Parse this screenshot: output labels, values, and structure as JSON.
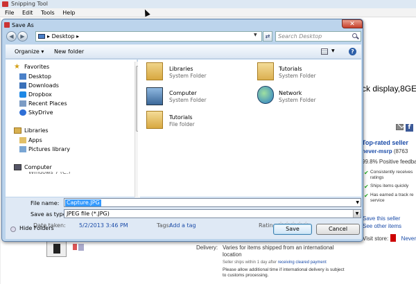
{
  "snipping_tool": {
    "title": "Snipping Tool",
    "menu": [
      "File",
      "Edit",
      "Tools",
      "Help"
    ]
  },
  "background_page": {
    "product_title_fragment": "ck display,8GE",
    "top_rated": "Top-rated seller",
    "seller_name": "never-msrp",
    "seller_count": "(8763",
    "feedback": "99.8% Positive feedba",
    "bullets": [
      "Consistently receives ratings",
      "Ships items quickly",
      "Has earned a track re service"
    ],
    "save_seller": "Save this seller",
    "see_other": "See other items",
    "visit_store": "Visit store:",
    "store_name": "Never",
    "delivery_label": "Delivery:",
    "delivery_value": "Varies for items shipped from an international location",
    "seller_ships_prefix": "Seller ships within 1 day after",
    "seller_ships_link": "receiving cleared payment",
    "allow_time": "Please allow additional time if international delivery is subject to customs processing."
  },
  "dialog": {
    "title": "Save As",
    "address_location": "Desktop",
    "search_placeholder": "Search Desktop",
    "toolbar": {
      "organize": "Organize",
      "new_folder": "New folder"
    },
    "nav": {
      "favorites_header": "Favorites",
      "favorites": [
        "Desktop",
        "Downloads",
        "Dropbox",
        "Recent Places",
        "SkyDrive"
      ],
      "libraries_header": "Libraries",
      "libraries": [
        "Apps",
        "Pictures library"
      ],
      "computer_header": "Computer",
      "computer_partial": "Windows 7 (C:)"
    },
    "files": [
      {
        "name": "Libraries",
        "type": "System Folder"
      },
      {
        "name": "Tutorials",
        "type": "System Folder"
      },
      {
        "name": "Computer",
        "type": "System Folder"
      },
      {
        "name": "Network",
        "type": "System Folder"
      },
      {
        "name": "Tutorials",
        "type": "File folder"
      }
    ],
    "file_name_label": "File name:",
    "file_name_value": "Capture.JPG",
    "save_type_label": "Save as type:",
    "save_type_value": "JPEG file (*.JPG)",
    "date_taken_label": "Date taken:",
    "date_taken_value": "5/2/2013 3:46 PM",
    "tags_label": "Tags:",
    "tags_value": "Add a tag",
    "rating_label": "Rating:",
    "rating_stars": "☆☆☆☆☆",
    "hide_folders": "Hide Folders",
    "save_button": "Save",
    "cancel_button": "Cancel"
  },
  "colors": {
    "link": "#1a4ba8",
    "selection": "#3399ff",
    "dialog_frame": "#bcd4ec"
  }
}
